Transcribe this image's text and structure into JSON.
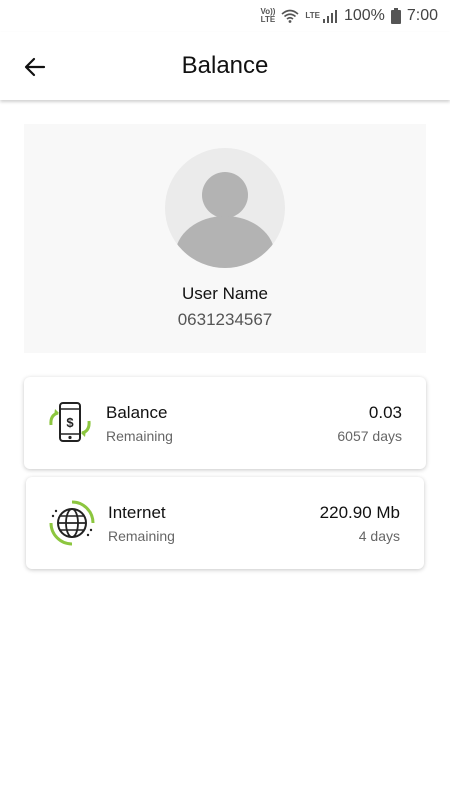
{
  "status_bar": {
    "volte": "Vo))",
    "volte_sub": "LTE",
    "lte": "LTE",
    "battery": "100%",
    "time": "7:00"
  },
  "header": {
    "title": "Balance",
    "back_icon": "arrow-left-icon"
  },
  "profile": {
    "name": "User Name",
    "phone": "0631234567",
    "avatar_icon": "person-icon"
  },
  "cards": [
    {
      "title": "Balance",
      "subtitle": "Remaining",
      "amount": "0.03",
      "days": "6057 days",
      "icon": "phone-dollar-refresh-icon"
    },
    {
      "title": "Internet",
      "subtitle": "Remaining",
      "amount": "220.90 Mb",
      "days": "4 days",
      "icon": "globe-icon"
    }
  ],
  "colors": {
    "accent_green": "#8cc63f",
    "icon_dark": "#222222"
  }
}
